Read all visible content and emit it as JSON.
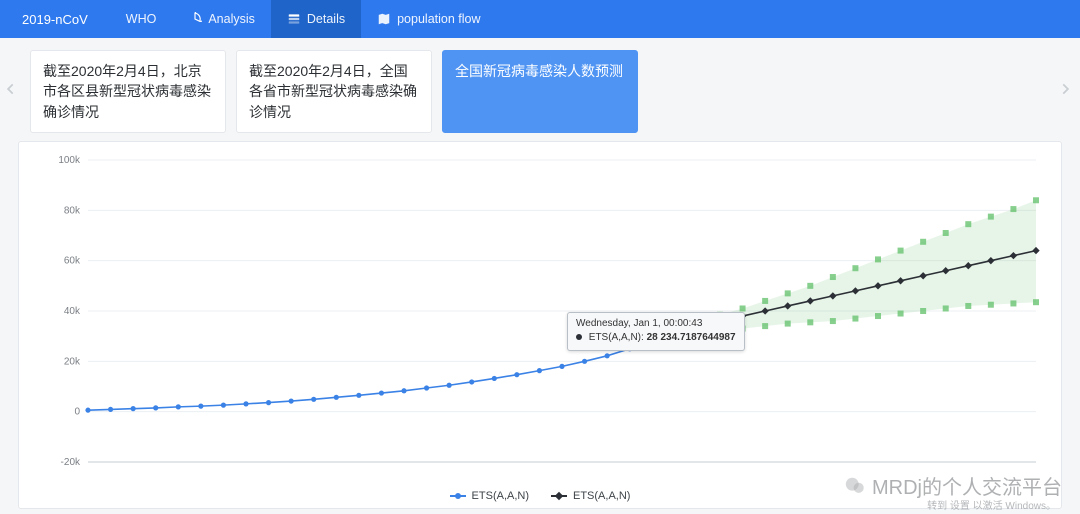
{
  "nav": {
    "brand": "2019-nCoV",
    "items": [
      {
        "label": "WHO",
        "icon": ""
      },
      {
        "label": "Analysis",
        "icon": "pie"
      },
      {
        "label": "Details",
        "icon": "layers",
        "active": true
      },
      {
        "label": "population flow",
        "icon": "map"
      }
    ]
  },
  "cards": [
    {
      "text": "截至2020年2月4日，北京市各区县新型冠状病毒感染确诊情况"
    },
    {
      "text": "截至2020年2月4日，全国各省市新型冠状病毒感染确诊情况"
    },
    {
      "text": "全国新冠病毒感染人数预测",
      "active": true
    }
  ],
  "tooltip": {
    "line1": "Wednesday, Jan 1, 00:00:43",
    "line2_label": "ETS(A,A,N):",
    "line2_value": "28 234.7187644987"
  },
  "legend": {
    "s1": "ETS(A,A,N)",
    "s2": "ETS(A,A,N)"
  },
  "watermark": {
    "main": "MRDj的个人交流平台",
    "sub": "转到 设置 以激活 Windows。"
  },
  "chart_data": {
    "type": "line",
    "title": "",
    "xlabel": "",
    "ylabel": "",
    "ylim": [
      -20000,
      100000
    ],
    "yticks": [
      -20000,
      0,
      20000,
      40000,
      60000,
      80000,
      100000
    ],
    "ytick_labels": [
      "-20k",
      "0",
      "20k",
      "40k",
      "60k",
      "80k",
      "100k"
    ],
    "x": [
      0,
      1,
      2,
      3,
      4,
      5,
      6,
      7,
      8,
      9,
      10,
      11,
      12,
      13,
      14,
      15,
      16,
      17,
      18,
      19,
      20,
      21,
      22,
      23,
      24,
      25,
      26,
      27,
      28,
      29,
      30,
      31,
      32,
      33,
      34,
      35,
      36,
      37,
      38,
      39,
      40,
      41,
      42
    ],
    "series": [
      {
        "name": "ETS(A,A,N)",
        "color": "#3b82e6",
        "values": [
          600,
          900,
          1200,
          1500,
          1900,
          2200,
          2600,
          3100,
          3600,
          4200,
          4900,
          5700,
          6500,
          7400,
          8300,
          9400,
          10500,
          11800,
          13200,
          14700,
          16300,
          18000,
          20000,
          22200,
          25000
        ],
        "x_start": 0
      },
      {
        "name": "ETS(A,A,N)",
        "color": "#2c3036",
        "values": [
          28234.72,
          30000,
          32000,
          34000,
          36000,
          38000,
          40000,
          42000,
          44000,
          46000,
          48000,
          50000,
          52000,
          54000,
          56000,
          58000,
          60000,
          62000,
          64000
        ],
        "x_start": 24
      }
    ],
    "forecast_band": {
      "x_start": 24,
      "upper": [
        28234.72,
        31000,
        33500,
        36000,
        38500,
        41000,
        44000,
        47000,
        50000,
        53500,
        57000,
        60500,
        64000,
        67500,
        71000,
        74500,
        77500,
        80500,
        84000
      ],
      "lower": [
        28234.72,
        29000,
        30000,
        31000,
        32000,
        33000,
        34000,
        35000,
        35500,
        36000,
        37000,
        38000,
        39000,
        40000,
        41000,
        42000,
        42500,
        43000,
        43500
      ],
      "color": "#69c371"
    },
    "highlight": {
      "x": 24,
      "value": 28234.7187644987
    }
  }
}
